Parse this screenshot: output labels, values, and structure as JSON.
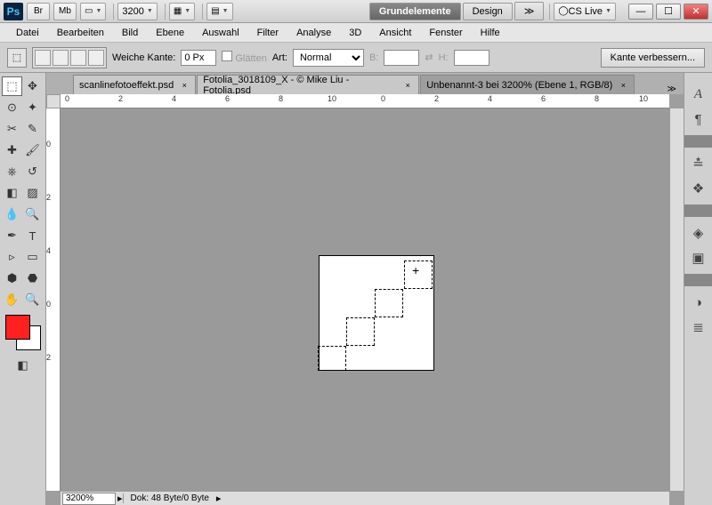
{
  "title_bar": {
    "zoom_display": "3200",
    "workspaces": [
      "Grundelemente",
      "Design"
    ],
    "active_workspace": 0,
    "cslive": "CS Live"
  },
  "menu": [
    "Datei",
    "Bearbeiten",
    "Bild",
    "Ebene",
    "Auswahl",
    "Filter",
    "Analyse",
    "3D",
    "Ansicht",
    "Fenster",
    "Hilfe"
  ],
  "options": {
    "feather_label": "Weiche Kante:",
    "feather_value": "0 Px",
    "antialias_label": "Glätten",
    "style_label": "Art:",
    "style_value": "Normal",
    "width_label": "B:",
    "height_label": "H:",
    "refine": "Kante verbessern..."
  },
  "doc_tabs": [
    {
      "label": "scanlinefotoeffekt.psd"
    },
    {
      "label": "Fotolia_3018109_X - © Mike Liu - Fotolia.psd"
    },
    {
      "label": "Unbenannt-3 bei 3200% (Ebene 1, RGB/8)"
    }
  ],
  "active_doc": 2,
  "ruler_h": [
    "0",
    "2",
    "4",
    "6",
    "8",
    "10",
    "0",
    "2",
    "4",
    "6",
    "8",
    "10"
  ],
  "ruler_v": [
    "0",
    "2",
    "4",
    "0",
    "2"
  ],
  "status": {
    "zoom": "3200%",
    "info": "Dok: 48 Byte/0 Byte"
  },
  "colors": {
    "fg": "#ff2020",
    "bg": "#ffffff"
  }
}
